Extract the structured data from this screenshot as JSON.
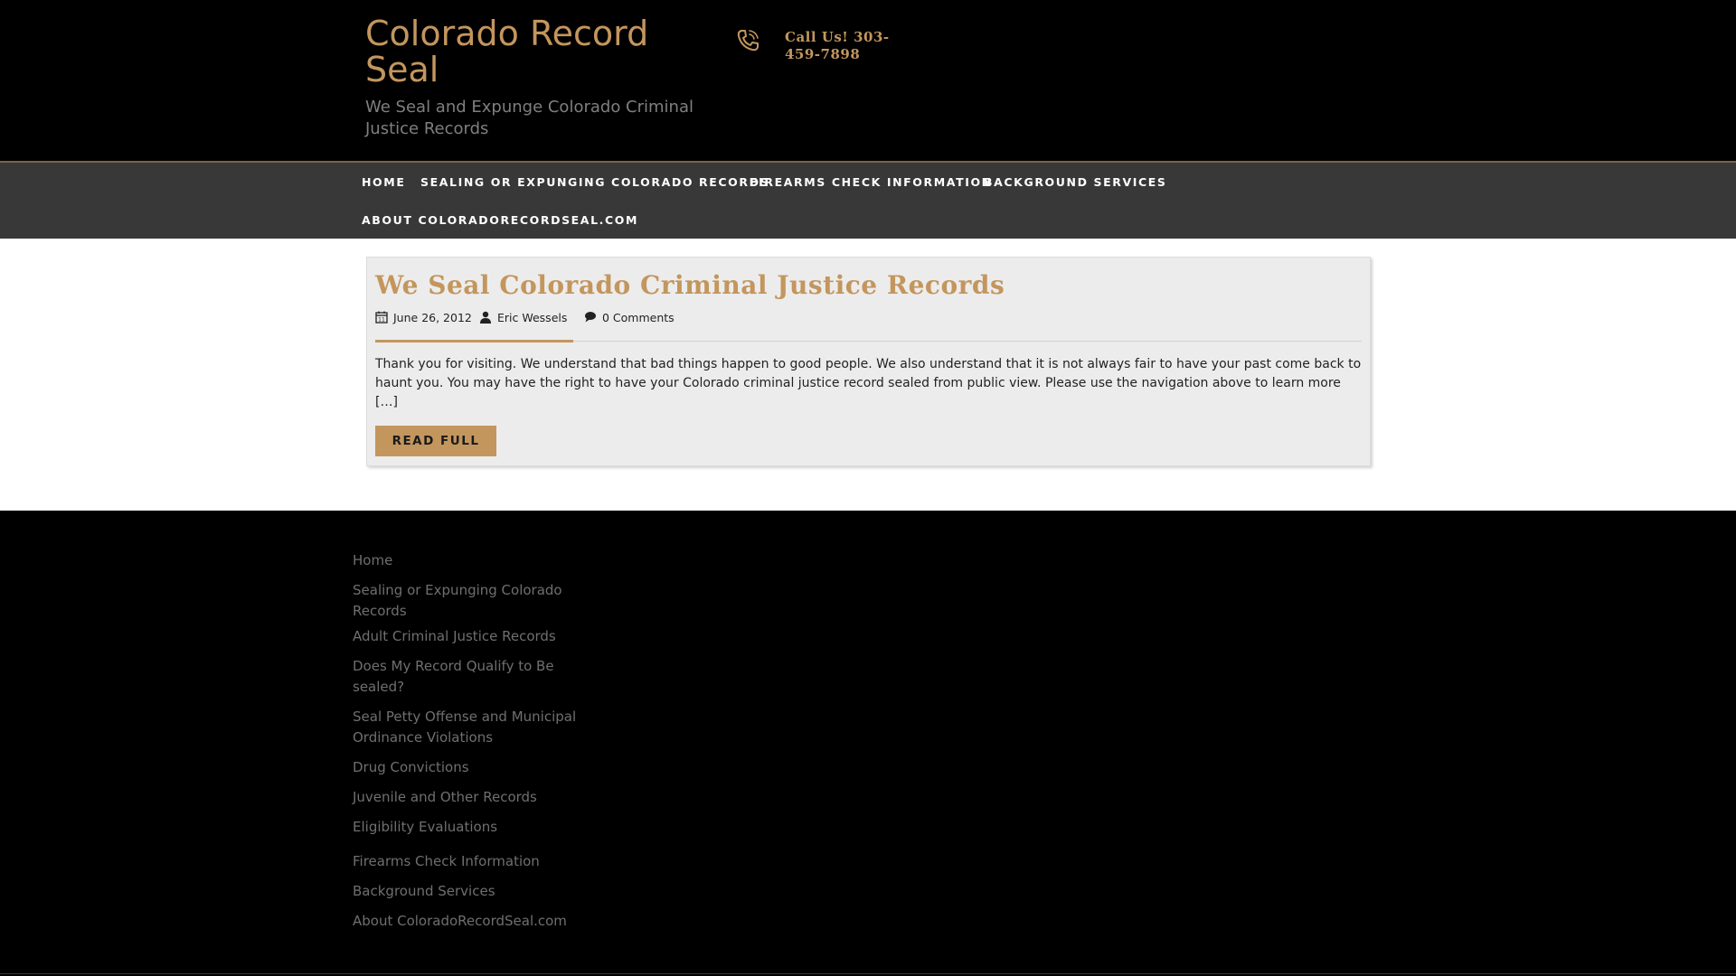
{
  "header": {
    "site_title": "Colorado Record Seal",
    "tagline": "We Seal and Expunge Colorado Criminal Justice Records",
    "phone_text": "Call Us! 303-459-7898",
    "phone_icon": "phone-icon"
  },
  "nav": {
    "items": [
      {
        "label": "Home"
      },
      {
        "label": "Sealing or Expunging Colorado Records"
      },
      {
        "label": "Firearms Check Information"
      },
      {
        "label": "Background Services"
      },
      {
        "label": "About ColoradoRecordSeal.com"
      }
    ]
  },
  "post": {
    "title": "We Seal Colorado Criminal Justice Records",
    "date": "June 26, 2012",
    "author": "Eric Wessels",
    "comments": "0 Comments",
    "excerpt": "Thank you for visiting. We understand that bad things happen to good people. We also understand that it is not always fair to have your past come back to haunt you. You may have the right to have your Colorado criminal justice record sealed from public view. Please use the navigation above to learn more […]",
    "read_more_label": "READ FULL"
  },
  "footer": {
    "links": [
      {
        "label": "Home"
      },
      {
        "label": "Sealing or Expunging Colorado Records"
      },
      {
        "label": "Adult Criminal Justice Records"
      },
      {
        "label": "Does My Record Qualify to Be sealed?"
      },
      {
        "label": "Seal Petty Offense and Municipal Ordinance Violations"
      },
      {
        "label": "Drug Convictions"
      },
      {
        "label": "Juvenile and Other Records"
      },
      {
        "label": "Eligibility Evaluations"
      },
      {
        "label": "Firearms Check Information"
      },
      {
        "label": "Background Services"
      },
      {
        "label": "About ColoradoRecordSeal.com"
      }
    ]
  },
  "colors": {
    "accent": "#c3965e",
    "header_bg": "#000000",
    "nav_bg": "#383838",
    "card_bg": "#ececec"
  }
}
